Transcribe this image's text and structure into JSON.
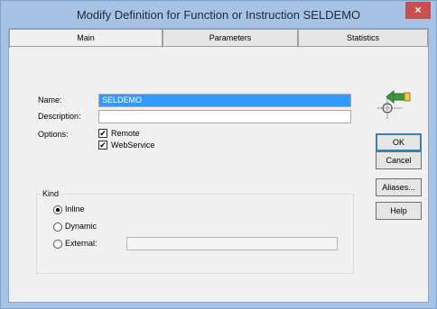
{
  "window": {
    "title": "Modify Definition for Function or Instruction SELDEMO",
    "close_glyph": "×"
  },
  "tabs": [
    {
      "label": "Main",
      "active": true
    },
    {
      "label": "Parameters",
      "active": false
    },
    {
      "label": "Statistics",
      "active": false
    }
  ],
  "form": {
    "name_label": "Name:",
    "name_value": "SELDEMO",
    "description_label": "Description:",
    "description_value": "",
    "options_label": "Options:",
    "options": [
      {
        "label": "Remote",
        "checked": true
      },
      {
        "label": "WebService",
        "checked": true
      }
    ]
  },
  "kind": {
    "legend": "Kind",
    "options": [
      {
        "label": "Inline",
        "selected": true
      },
      {
        "label": "Dynamic",
        "selected": false
      },
      {
        "label": "External:",
        "selected": false
      }
    ],
    "external_value": ""
  },
  "buttons": {
    "ok": "OK",
    "cancel": "Cancel",
    "aliases": "Aliases...",
    "help": "Help"
  },
  "icon": "function-definition-icon",
  "colors": {
    "selection": "#3399ff",
    "close": "#c75050",
    "frame": "#a6c3e6"
  }
}
